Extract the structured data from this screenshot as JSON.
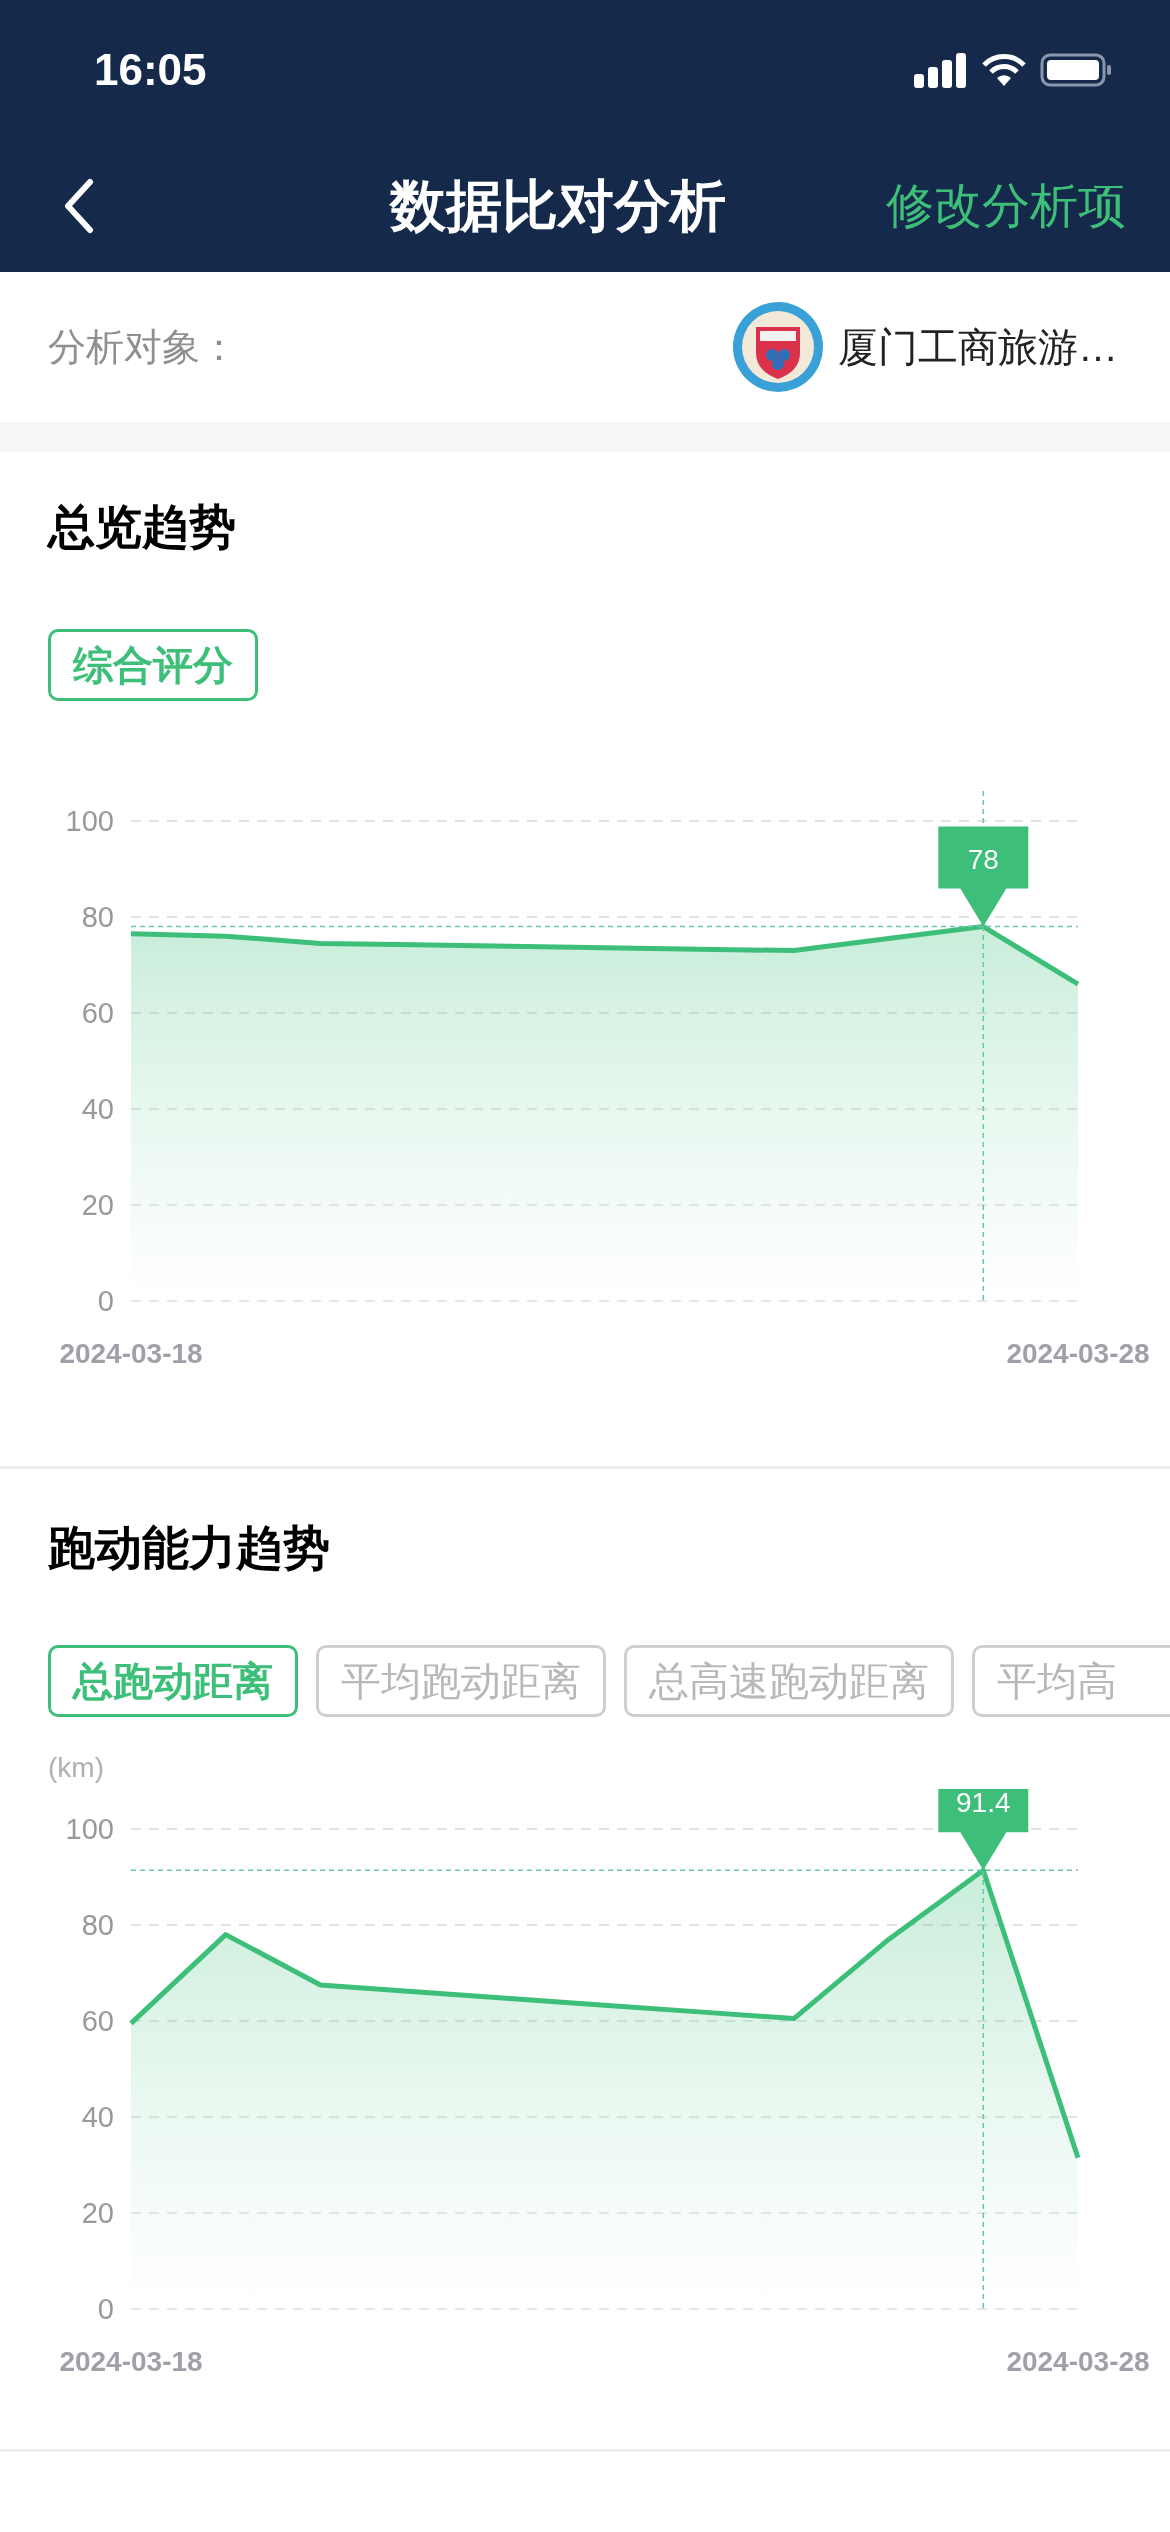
{
  "status_bar": {
    "time": "16:05"
  },
  "nav": {
    "title": "数据比对分析",
    "action": "修改分析项"
  },
  "subject": {
    "label": "分析对象：",
    "name": "厦门工商旅游…"
  },
  "sections": [
    {
      "title": "总览趋势",
      "tabs": [
        {
          "label": "综合评分",
          "selected": true
        }
      ],
      "chart_data": {
        "type": "area",
        "grid": true,
        "categories": [
          "2024-03-18",
          null,
          null,
          null,
          null,
          null,
          null,
          null,
          null,
          null,
          "2024-03-28"
        ],
        "series": [
          {
            "color": "#3dbf7a",
            "values": [
              76.5,
              76,
              74.5,
              74.2,
              73.9,
              73.6,
              73.3,
              73,
              75.5,
              78,
              66
            ]
          }
        ],
        "ylim": [
          0,
          100
        ],
        "yticks": [
          0,
          20,
          40,
          60,
          80,
          100
        ],
        "annotations": [
          {
            "y": 78,
            "text": "78"
          }
        ],
        "ref_lines": [
          {
            "axis": "y",
            "value": 78,
            "color": "#66c9a6"
          }
        ]
      }
    },
    {
      "title": "跑动能力趋势",
      "tabs": [
        {
          "label": "总跑动距离",
          "selected": true
        },
        {
          "label": "平均跑动距离",
          "selected": false
        },
        {
          "label": "总高速跑动距离",
          "selected": false
        },
        {
          "label": "平均高",
          "selected": false
        }
      ],
      "chart_data": {
        "type": "area",
        "grid": true,
        "ylabel": "(km)",
        "categories": [
          "2024-03-18",
          null,
          null,
          null,
          null,
          null,
          null,
          null,
          null,
          null,
          "2024-03-28"
        ],
        "series": [
          {
            "color": "#3dbf7a",
            "values": [
              59.5,
              78,
              67.5,
              66.1,
              64.7,
              63.3,
              61.9,
              60.5,
              77,
              91.4,
              31.5
            ]
          }
        ],
        "ylim": [
          0,
          100
        ],
        "yticks": [
          0,
          20,
          40,
          60,
          80,
          100
        ],
        "annotations": [
          {
            "y": 91.4,
            "text": "91.4"
          }
        ],
        "ref_lines": [
          {
            "axis": "y",
            "value": 91.4,
            "color": "#66c9a6"
          }
        ]
      }
    }
  ]
}
